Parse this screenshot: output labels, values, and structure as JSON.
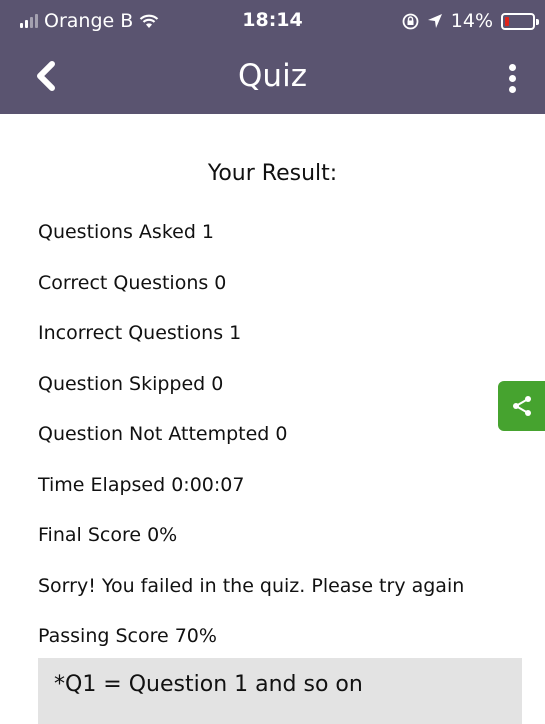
{
  "status_bar": {
    "carrier": "Orange B",
    "time": "18:14",
    "battery_percent": "14%",
    "battery_level": 0.14,
    "battery_color": "#e0231b"
  },
  "app_bar": {
    "title": "Quiz",
    "background_color": "#5a5470",
    "back_icon": "chevron-left-icon",
    "menu_icon": "more-vertical-icon"
  },
  "result": {
    "heading": "Your Result:",
    "rows": [
      "Questions Asked 1",
      "Correct Questions 0",
      "Incorrect Questions 1",
      "Question Skipped 0",
      "Question Not Attempted 0",
      "Time Elapsed 0:00:07",
      "Final Score 0%",
      "Sorry! You failed in the quiz. Please try again",
      "Passing Score 70%"
    ],
    "note": "*Q1 = Question 1 and so on"
  },
  "share_button": {
    "icon": "share-icon",
    "color": "#46a32f"
  }
}
